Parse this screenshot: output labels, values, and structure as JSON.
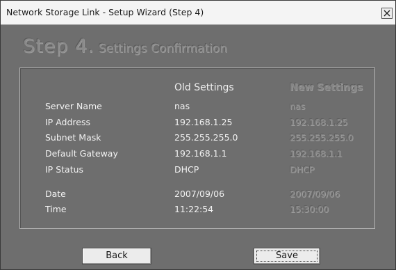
{
  "window": {
    "title": "Network Storage Link - Setup Wizard (Step 4)"
  },
  "heading": {
    "step": "Step 4.",
    "title": "Settings Confirmation"
  },
  "columns": {
    "old": "Old Settings",
    "new": "New Settings"
  },
  "rows": [
    {
      "label": "Server Name",
      "old": "nas",
      "new": "nas"
    },
    {
      "label": "IP Address",
      "old": "192.168.1.25",
      "new": "192.168.1.25"
    },
    {
      "label": "Subnet Mask",
      "old": "255.255.255.0",
      "new": "255.255.255.0"
    },
    {
      "label": "Default Gateway",
      "old": "192.168.1.1",
      "new": "192.168.1.1"
    },
    {
      "label": "IP Status",
      "old": "DHCP",
      "new": "DHCP"
    },
    {
      "label": "Date",
      "old": "2007/09/06",
      "new": "2007/09/06"
    },
    {
      "label": "Time",
      "old": "11:22:54",
      "new": "15:30:00"
    }
  ],
  "buttons": {
    "back": "Back",
    "save": "Save"
  }
}
